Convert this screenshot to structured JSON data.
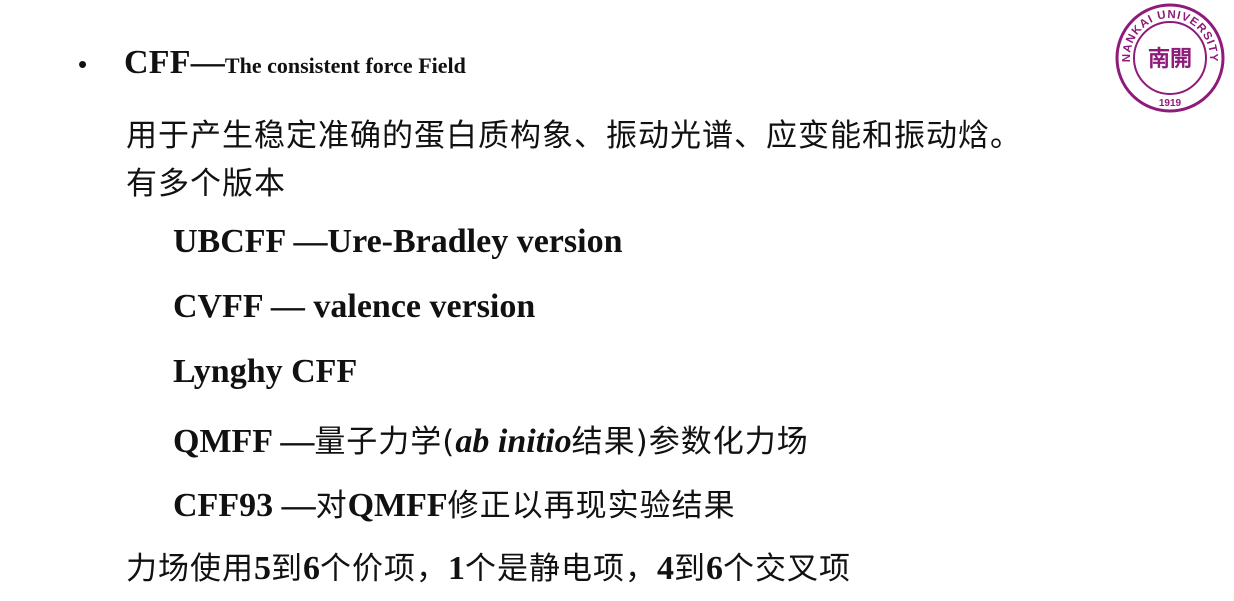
{
  "heading": {
    "bullet": "•",
    "main": "CFF—",
    "sub": "The consistent force Field"
  },
  "description": {
    "line1": "用于产生稳定准确的蛋白质构象、振动光谱、应变能和振动焓。",
    "line2": "有多个版本"
  },
  "versions": {
    "ubcff": "UBCFF —Ure-Bradley version",
    "cvff": "CVFF — valence version",
    "lynghy": "Lynghy CFF",
    "qmff": {
      "prefix": "QMFF —",
      "cn1": "量子力学(",
      "italic": "ab initio",
      "cn2": "结果)参数化力场"
    },
    "cff93": {
      "prefix": "CFF93 —",
      "cn1": "对",
      "mid": "QMFF",
      "cn2": "修正以再现实验结果"
    }
  },
  "footer": {
    "parts": [
      "力场使用",
      "5",
      "到",
      "6",
      "个价项，",
      "1",
      "个是静电项，",
      "4",
      "到",
      "6",
      "个交叉项"
    ]
  },
  "logo": {
    "text_ring": "NANKAI UNIVERSITY",
    "year": "1919",
    "center": "南開",
    "color": "#8e1b7a"
  }
}
